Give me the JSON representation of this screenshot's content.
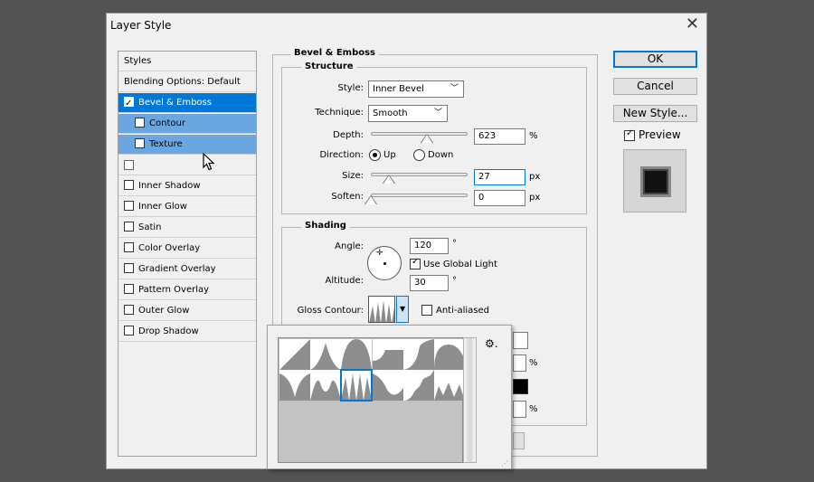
{
  "dialog": {
    "title": "Layer Style",
    "close_glyph": "✕"
  },
  "styles_panel": {
    "header": "Styles",
    "items": [
      {
        "label": "Blending Options: Default",
        "checkbox": false,
        "checked": false,
        "state": "normal"
      },
      {
        "label": "Bevel & Emboss",
        "checkbox": true,
        "checked": true,
        "state": "selected"
      },
      {
        "label": "Contour",
        "checkbox": true,
        "checked": false,
        "state": "sub"
      },
      {
        "label": "Texture",
        "checkbox": true,
        "checked": false,
        "state": "sub"
      },
      {
        "label": "",
        "checkbox": true,
        "checked": false,
        "state": "focus"
      },
      {
        "label": "Inner Shadow",
        "checkbox": true,
        "checked": false,
        "state": "normal"
      },
      {
        "label": "Inner Glow",
        "checkbox": true,
        "checked": false,
        "state": "normal"
      },
      {
        "label": "Satin",
        "checkbox": true,
        "checked": false,
        "state": "normal"
      },
      {
        "label": "Color Overlay",
        "checkbox": true,
        "checked": false,
        "state": "normal"
      },
      {
        "label": "Gradient Overlay",
        "checkbox": true,
        "checked": false,
        "state": "normal"
      },
      {
        "label": "Pattern Overlay",
        "checkbox": true,
        "checked": false,
        "state": "normal"
      },
      {
        "label": "Outer Glow",
        "checkbox": true,
        "checked": false,
        "state": "normal"
      },
      {
        "label": "Drop Shadow",
        "checkbox": true,
        "checked": false,
        "state": "normal"
      }
    ]
  },
  "bevel": {
    "section_title": "Bevel & Emboss",
    "structure": {
      "title": "Structure",
      "style_label": "Style:",
      "style_value": "Inner Bevel",
      "technique_label": "Technique:",
      "technique_value": "Smooth",
      "depth_label": "Depth:",
      "depth_value": "623",
      "depth_unit": "%",
      "depth_level": 0.62,
      "direction_label": "Direction:",
      "direction_up": "Up",
      "direction_down": "Down",
      "direction_selected": "Up",
      "size_label": "Size:",
      "size_value": "27",
      "size_unit": "px",
      "size_level": 0.2,
      "soften_label": "Soften:",
      "soften_value": "0",
      "soften_unit": "px",
      "soften_level": 0.0
    },
    "shading": {
      "title": "Shading",
      "angle_label": "Angle:",
      "angle_value": "120",
      "angle_unit": "°",
      "use_global_light": "Use Global Light",
      "use_global_light_checked": true,
      "altitude_label": "Altitude:",
      "altitude_value": "30",
      "altitude_unit": "°",
      "gloss_label": "Gloss Contour:",
      "anti_aliased": "Anti-aliased",
      "anti_aliased_checked": false,
      "partial_units": [
        "%",
        "%"
      ]
    }
  },
  "buttons": {
    "ok": "OK",
    "cancel": "Cancel",
    "new_style": "New Style...",
    "preview": "Preview",
    "preview_checked": true
  },
  "popup": {
    "gear_icon": "⚙.",
    "selected_index": 8,
    "cells": 12
  },
  "colors": {
    "accent": "#0078d7",
    "sub_highlight": "#6aa6e0",
    "swatch_black": "#000000"
  }
}
